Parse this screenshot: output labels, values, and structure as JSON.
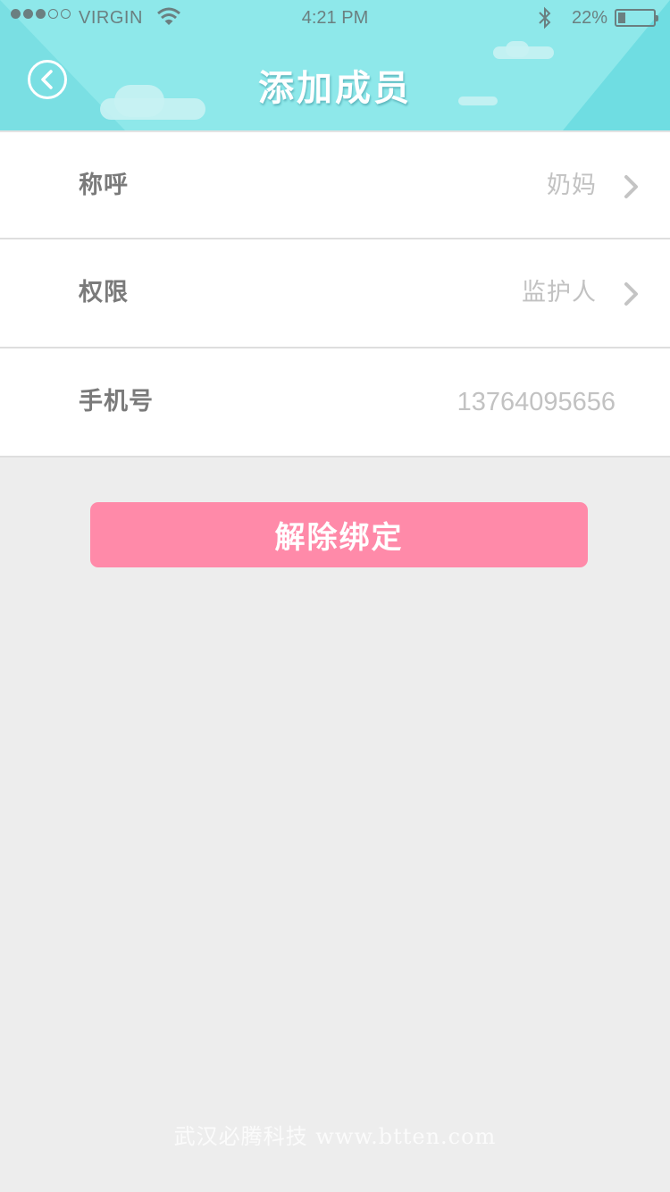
{
  "status_bar": {
    "carrier": "VIRGIN",
    "time": "4:21 PM",
    "battery_percent": "22%",
    "battery_level": 0.22,
    "signal_bars_filled": 3,
    "signal_bars_total": 5
  },
  "header": {
    "title": "添加成员",
    "back_icon": "back-chevron-icon",
    "background_color": "#8ee8ea"
  },
  "form": {
    "rows": [
      {
        "label": "称呼",
        "value": "奶妈"
      },
      {
        "label": "权限",
        "value": "监护人"
      },
      {
        "label": "手机号",
        "value": "13764095656"
      }
    ]
  },
  "actions": {
    "unbind_label": "解除绑定",
    "unbind_color": "#ff8aa9"
  },
  "watermark": "武汉必腾科技 www.btten.com"
}
